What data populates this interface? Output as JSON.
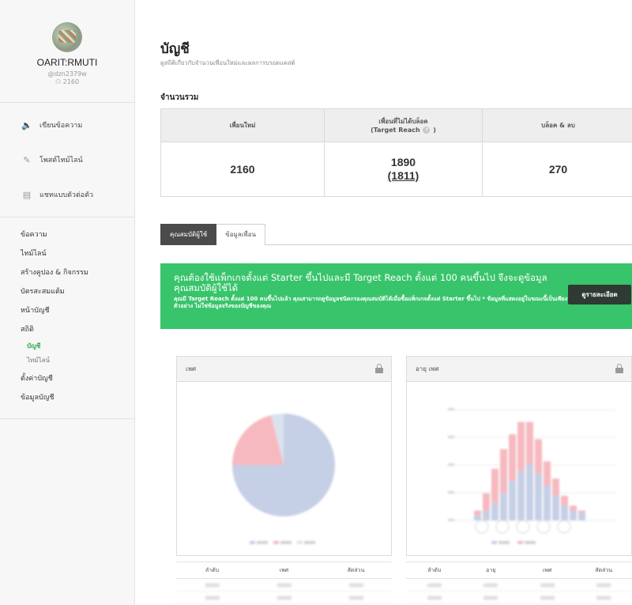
{
  "sidebar": {
    "profile": {
      "name": "OARIT:RMUTI",
      "id": "@dzn2379w",
      "friends": "2160"
    },
    "actions": [
      {
        "label": "เขียนข้อความ",
        "icon": "speaker-icon"
      },
      {
        "label": "โพสต์ไทม์ไลน์",
        "icon": "edit-icon"
      },
      {
        "label": "แชทแบบตัวต่อตัว",
        "icon": "chat-icon"
      }
    ],
    "nav": [
      {
        "label": "ข้อความ"
      },
      {
        "label": "ไทม์ไลน์"
      },
      {
        "label": "สร้างคูปอง & กิจกรรม"
      },
      {
        "label": "บัตรสะสมแต้ม"
      },
      {
        "label": "หน้าบัญชี"
      },
      {
        "label": "สถิติ"
      }
    ],
    "stats_sub": [
      {
        "label": "บัญชี",
        "active": true
      },
      {
        "label": "ไทม์ไลน์",
        "active": false
      }
    ],
    "nav_bottom": [
      {
        "label": "ตั้งค่าบัญชี"
      },
      {
        "label": "ข้อมูลบัญชี"
      }
    ]
  },
  "main": {
    "title": "บัญชี",
    "subtitle": "ดูสถิติเกี่ยวกับจำนวนเพื่อนใหม่และผลการบรอดแคสต์",
    "section_title": "จำนวนรวม",
    "stats": {
      "headers": {
        "new_friends": "เพื่อนใหม่",
        "target_reach_line1": "เพื่อนที่ไม่ได้บล็อค",
        "target_reach_line2": "(Target Reach",
        "target_reach_close": ")",
        "blocked": "บล็อค & ลบ"
      },
      "values": {
        "new_friends": "2160",
        "target_reach": "1890",
        "target_reach_sub": "(1811)",
        "blocked": "270"
      }
    },
    "tabs": [
      {
        "label": "คุณสมบัติผู้ใช้",
        "active": true
      },
      {
        "label": "ข้อมูลเพื่อน",
        "active": false
      }
    ],
    "banner": {
      "title": "คุณต้องใช้แพ็กเกจตั้งแต่ Starter ขึ้นไปและมี Target Reach ตั้งแต่ 100 คนขึ้นไป จึงจะดูข้อมูลคุณสมบัติผู้ใช้ได้",
      "desc": "คุณมี Target Reach ตั้งแต่ 100 คนขึ้นไปแล้ว คุณสามารถดูข้อมูลชนิดกรองคุณสมบัติได้เมื่อซื้อแพ็กเกจตั้งแต่ Starter ขึ้นไป * ข้อมูลที่แสดงอยู่ในขณะนี้เป็นเพียงตัวอย่าง ไม่ใช่ข้อมูลจริงของบัญชีของคุณ",
      "button": "ดูรายละเอียด",
      "color": "#38c46b"
    },
    "panels": {
      "gender": {
        "title": "เพศ",
        "table_headers": [
          "ลำดับ",
          "เพศ",
          "สัดส่วน"
        ]
      },
      "age_gender": {
        "title": "อายุ เพศ",
        "table_headers": [
          "ลำดับ",
          "อายุ",
          "เพศ",
          "สัดส่วน"
        ]
      }
    }
  },
  "chart_data": [
    {
      "type": "pie",
      "title": "เพศ",
      "values": [
        75,
        21,
        4
      ],
      "colors": [
        "#c5cfe6",
        "#f6b9bf",
        "#dbe2ef"
      ]
    },
    {
      "type": "bar",
      "title": "อายุ เพศ",
      "categories": [
        "1",
        "2",
        "3",
        "4",
        "5",
        "6",
        "7",
        "8",
        "9",
        "10",
        "11",
        "12",
        "13"
      ],
      "series": [
        {
          "values": [
            2,
            4,
            7,
            11,
            16,
            20,
            23,
            19,
            14,
            10,
            6,
            4,
            3
          ],
          "color": "#c5cfe6"
        },
        {
          "values": [
            2,
            7,
            14,
            18,
            19,
            20,
            17,
            14,
            10,
            7,
            4,
            2,
            1
          ],
          "color": "#f6b9bf"
        }
      ]
    }
  ]
}
